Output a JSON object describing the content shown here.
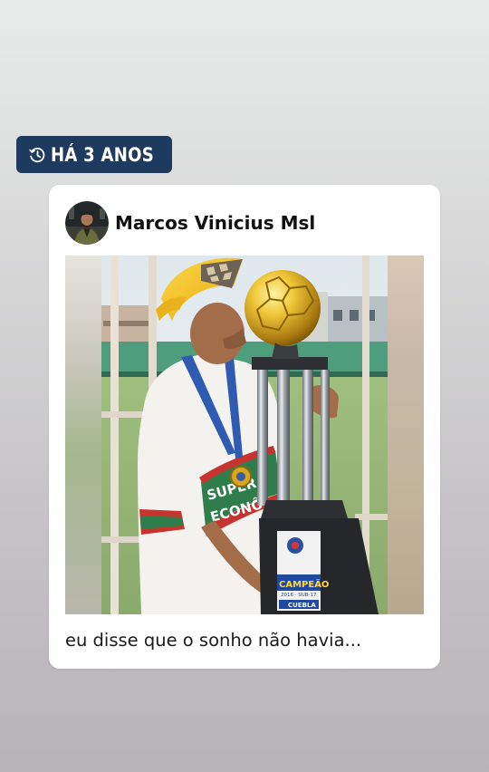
{
  "memory_badge": {
    "icon": "history-clock-icon",
    "label": "HÁ 3 ANOS",
    "background_color": "#1f3a5f"
  },
  "post": {
    "author": {
      "name": "Marcos Vinicius Msl",
      "avatar_icon": "avatar"
    },
    "photo": {
      "trophy_label_1": "CAMPEÃO",
      "trophy_label_2": "2016 · SUB-17",
      "trophy_label_3": "CUEBLA",
      "jersey_text_1": "SUPER",
      "jersey_text_2": "ECONÔ"
    },
    "caption": "eu disse que o sonho não havia..."
  }
}
